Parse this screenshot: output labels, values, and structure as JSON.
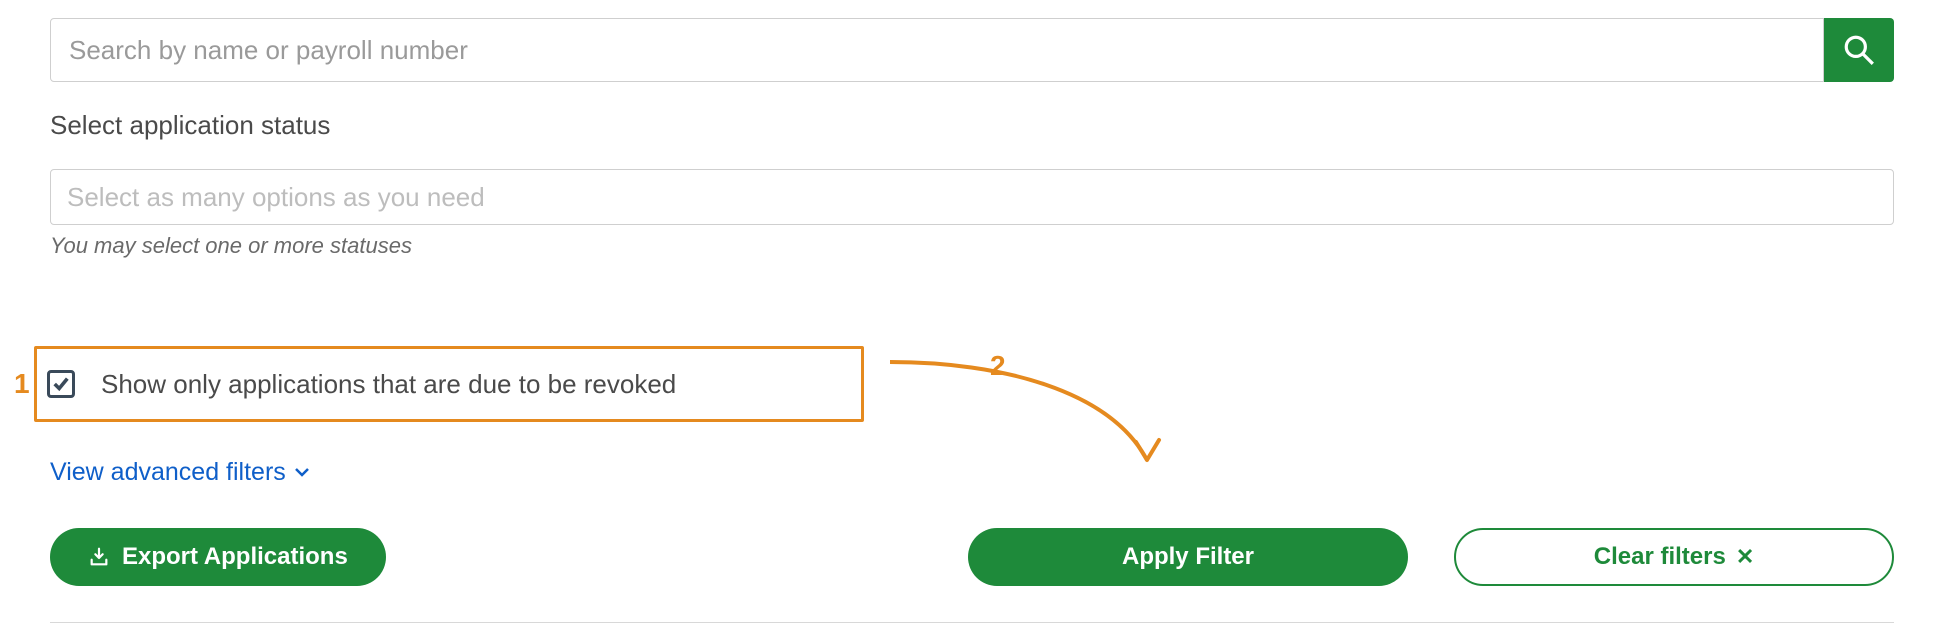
{
  "search": {
    "placeholder": "Search by name or payroll number",
    "value": ""
  },
  "status": {
    "label": "Select application status",
    "placeholder": "Select as many options as you need",
    "help": "You may select one or more statuses"
  },
  "revoked_checkbox": {
    "label": "Show only applications that are due to be revoked",
    "checked": true
  },
  "advanced_filters": {
    "label": "View advanced filters"
  },
  "buttons": {
    "export": "Export Applications",
    "apply": "Apply Filter",
    "clear": "Clear filters"
  },
  "annotations": {
    "one": "1",
    "two": "2"
  },
  "colors": {
    "primary_green": "#1e8a3a",
    "link_blue": "#0f5fc9",
    "annotation_orange": "#e58a1f"
  }
}
